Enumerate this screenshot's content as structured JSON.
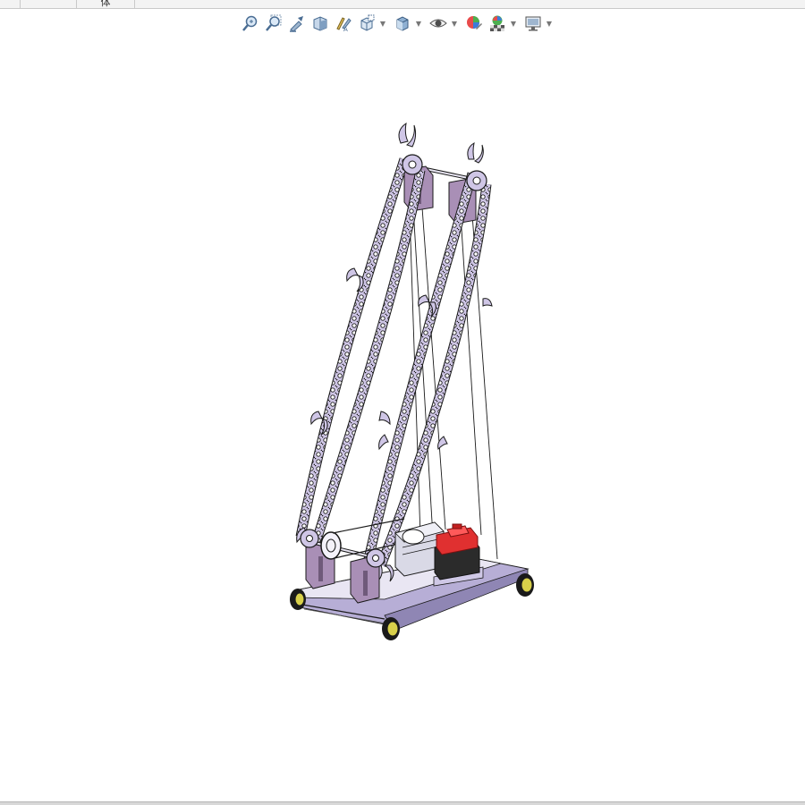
{
  "window": {
    "tabs": [
      {
        "label": ""
      },
      {
        "label": ""
      },
      {
        "label": "体"
      }
    ]
  },
  "heads_up_toolbar": {
    "items": [
      {
        "icon": "zoom-to-fit-icon",
        "dropdown": false
      },
      {
        "icon": "zoom-to-area-icon",
        "dropdown": false
      },
      {
        "icon": "previous-view-icon",
        "dropdown": false
      },
      {
        "icon": "section-view-icon",
        "dropdown": false
      },
      {
        "icon": "dynamic-annotation-icon",
        "dropdown": false
      },
      {
        "icon": "view-orientation-icon",
        "dropdown": true
      },
      {
        "icon": "display-style-icon",
        "dropdown": true
      },
      {
        "icon": "hide-show-items-icon",
        "dropdown": true
      },
      {
        "icon": "edit-appearance-icon",
        "dropdown": false
      },
      {
        "icon": "apply-scene-icon",
        "dropdown": true
      },
      {
        "icon": "view-settings-icon",
        "dropdown": true
      }
    ]
  },
  "model": {
    "name": "",
    "colors": {
      "chain": "#c9bfe0",
      "frame": "#b9b0d6",
      "bracket": "#a98fb6",
      "motor_cover": "#e03030",
      "motor_body": "#2b2b2b",
      "gearbox": "#d9d9e6",
      "wheel_rim": "#d8d04a",
      "outline": "#1a1a1a"
    }
  }
}
